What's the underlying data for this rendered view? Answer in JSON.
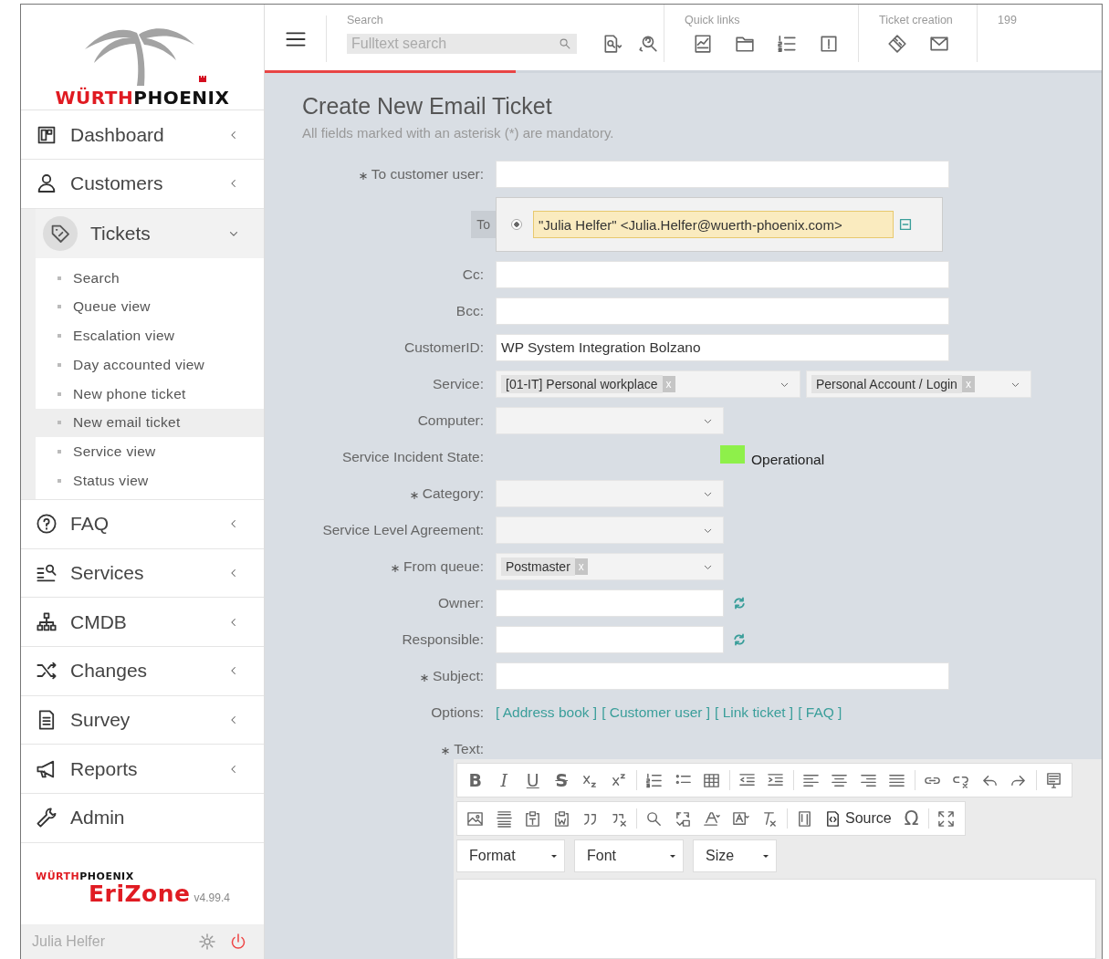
{
  "brand": {
    "first": "WÜRTH",
    "second": "PHOENIX"
  },
  "sidebar": {
    "items": [
      {
        "label": "Dashboard",
        "expanded": false
      },
      {
        "label": "Customers",
        "expanded": false
      },
      {
        "label": "Tickets",
        "expanded": true,
        "children": [
          {
            "label": "Search",
            "selected": false
          },
          {
            "label": "Queue view",
            "selected": false
          },
          {
            "label": "Escalation view",
            "selected": false
          },
          {
            "label": "Day accounted view",
            "selected": false
          },
          {
            "label": "New phone ticket",
            "selected": false
          },
          {
            "label": "New email ticket",
            "selected": true
          },
          {
            "label": "Service view",
            "selected": false
          },
          {
            "label": "Status view",
            "selected": false
          }
        ]
      },
      {
        "label": "FAQ",
        "expanded": false
      },
      {
        "label": "Services",
        "expanded": false
      },
      {
        "label": "CMDB",
        "expanded": false
      },
      {
        "label": "Changes",
        "expanded": false
      },
      {
        "label": "Survey",
        "expanded": false
      },
      {
        "label": "Reports",
        "expanded": false
      },
      {
        "label": "Admin"
      }
    ]
  },
  "footer": {
    "brand": {
      "first": "WÜRTH",
      "second": "PHOENIX"
    },
    "product": "EriZone",
    "version": "v4.99.4",
    "user": "Julia Helfer"
  },
  "topbar": {
    "search": {
      "label": "Search",
      "placeholder": "Fulltext search"
    },
    "quick_links": {
      "label": "Quick links"
    },
    "ticket_creation": {
      "label": "Ticket creation"
    },
    "count": "199",
    "loading": {
      "level": 0.3
    }
  },
  "page": {
    "title": "Create New Email Ticket",
    "subtitle": "All fields marked with an asterisk (*) are mandatory."
  },
  "form": {
    "rows": [
      {
        "kind": "input",
        "label": "To customer user:",
        "required": true,
        "value": ""
      },
      {
        "kind": "recipient",
        "label": "To",
        "selected": true,
        "value": "\"Julia Helfer\" <Julia.Helfer@wuerth-phoenix.com>"
      },
      {
        "kind": "input",
        "label": "Cc:",
        "required": false,
        "value": ""
      },
      {
        "kind": "input",
        "label": "Bcc:",
        "required": false,
        "value": ""
      },
      {
        "kind": "input",
        "label": "CustomerID:",
        "required": false,
        "value": "WP System Integration Bolzano"
      },
      {
        "kind": "select_pair",
        "label": "Service:",
        "required": false,
        "tags": [
          "[01-IT] Personal workplace",
          "Personal Account / Login"
        ],
        "removes": [
          "x",
          "x"
        ]
      },
      {
        "kind": "select",
        "label": "Computer:",
        "required": false
      },
      {
        "kind": "state",
        "label": "Service Incident State:",
        "required": false,
        "color": "#8ef04a",
        "value": "Operational"
      },
      {
        "kind": "select",
        "label": "Category:",
        "required": true
      },
      {
        "kind": "select",
        "label": "Service Level Agreement:",
        "required": false
      },
      {
        "kind": "select",
        "label": "From queue:",
        "required": true,
        "tag": "Postmaster",
        "remove": "x"
      },
      {
        "kind": "user",
        "label": "Owner:",
        "required": false,
        "value": ""
      },
      {
        "kind": "user",
        "label": "Responsible:",
        "required": false,
        "value": ""
      },
      {
        "kind": "input",
        "label": "Subject:",
        "required": true,
        "value": ""
      },
      {
        "kind": "links",
        "label": "Options:",
        "required": false,
        "links": [
          "[ Address book ]",
          "[ Customer user ]",
          "[ Link ticket ]",
          "[ FAQ ]"
        ]
      },
      {
        "kind": "heading",
        "label": "Text:",
        "required": true
      }
    ]
  },
  "editor": {
    "letters": [
      "B",
      "I",
      "U",
      "S"
    ],
    "source": "Source",
    "special_char": "Ω",
    "dropdowns": [
      "Format",
      "Font",
      "Size"
    ]
  }
}
